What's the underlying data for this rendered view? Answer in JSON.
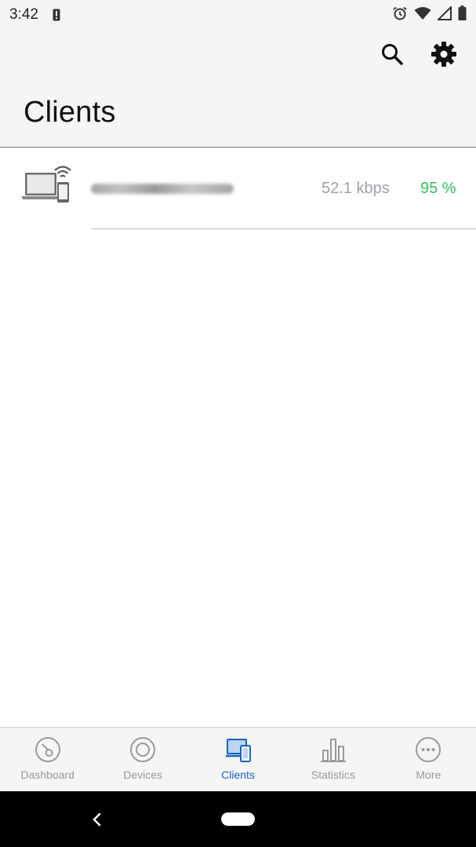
{
  "status_bar": {
    "time": "3:42",
    "icons": [
      "alert-icon",
      "alarm-icon",
      "wifi-icon",
      "cell-signal-icon",
      "battery-icon"
    ]
  },
  "app_bar": {
    "title": "Clients",
    "actions": [
      "search-icon",
      "gear-icon"
    ]
  },
  "clients": [
    {
      "name": "",
      "icon": "laptop-phone-wifi-icon",
      "speed": "52.1 kbps",
      "signal": "95 %"
    }
  ],
  "bottom_nav": {
    "items": [
      {
        "label": "Dashboard",
        "icon": "dashboard-gauge-icon",
        "active": false
      },
      {
        "label": "Devices",
        "icon": "devices-circle-icon",
        "active": false
      },
      {
        "label": "Clients",
        "icon": "clients-devices-icon",
        "active": true
      },
      {
        "label": "Statistics",
        "icon": "bar-chart-icon",
        "active": false
      },
      {
        "label": "More",
        "icon": "more-dots-icon",
        "active": false
      }
    ]
  },
  "colors": {
    "accent": "#1565c0",
    "signal_good": "#2fbf5a",
    "muted_text": "#a0a0a8"
  }
}
